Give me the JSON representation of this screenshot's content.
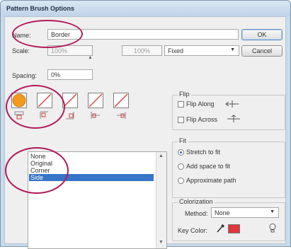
{
  "window": {
    "title": "Pattern Brush Options"
  },
  "name": {
    "label": "Name:",
    "value": "Border"
  },
  "scale": {
    "label": "Scale:",
    "value": "100%",
    "second_value": "100%",
    "mode": "Fixed"
  },
  "spacing": {
    "label": "Spacing:",
    "value": "0%"
  },
  "buttons": {
    "ok": "OK",
    "cancel": "Cancel"
  },
  "tiles": [
    "Side tile",
    "Outer corner tile",
    "Inner corner tile",
    "Start tile",
    "End tile"
  ],
  "tile_list": {
    "items": [
      "None",
      "Original",
      "Corner",
      "Side"
    ],
    "selected": "Side"
  },
  "flip": {
    "title": "Flip",
    "along": "Flip Along",
    "across": "Flip Across"
  },
  "fit": {
    "title": "Fit",
    "options": [
      "Stretch to fit",
      "Add space to fit",
      "Approximate path"
    ],
    "selected": "Stretch to fit"
  },
  "colorization": {
    "title": "Colorization",
    "method_label": "Method:",
    "method_value": "None",
    "key_color_label": "Key Color:",
    "key_color": "#e0363c"
  },
  "colors": {
    "annotation": "#b01b5b",
    "selection": "#3675c7"
  }
}
